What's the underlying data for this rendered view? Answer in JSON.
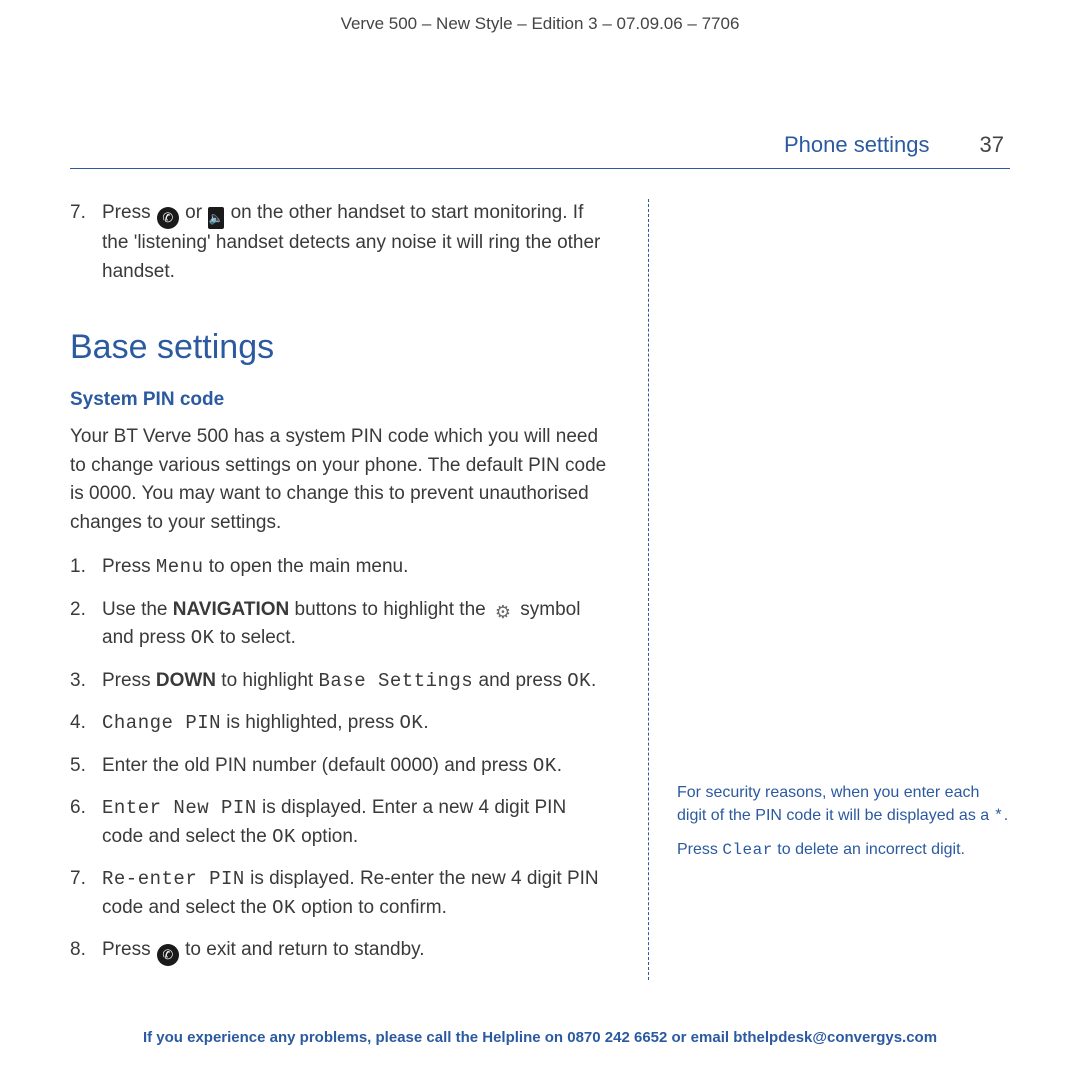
{
  "header": "Verve 500 – New Style – Edition 3 – 07.09.06 – 7706",
  "section": {
    "title": "Phone settings",
    "page": "37"
  },
  "top_step": {
    "n": "7.",
    "t1": "Press ",
    "t2": " or ",
    "t3": " on the other handset to start monitoring. If the 'listening' handset detects any noise it will ring the other handset."
  },
  "heading": "Base settings",
  "subheading": "System PIN code",
  "intro": "Your BT Verve 500 has a system PIN code which you will need to change various settings on your phone. The default PIN code is 0000. You may want to change this to prevent unauthorised changes to your settings.",
  "steps": {
    "s1a": "Press ",
    "s1_menu": "Menu",
    "s1b": " to open the main menu.",
    "s2a": "Use the ",
    "s2_nav": "NAVIGATION",
    "s2b": " buttons to highlight the ",
    "s2c": " symbol and press ",
    "s2_ok": "OK",
    "s2d": " to select.",
    "s3a": "Press ",
    "s3_down": "DOWN",
    "s3b": " to highlight ",
    "s3_bs": "Base Settings",
    "s3c": " and press ",
    "s3_ok": "OK",
    "s3d": ".",
    "s4_cp": "Change PIN",
    "s4a": " is highlighted, press ",
    "s4_ok": "OK",
    "s4b": ".",
    "s5a": "Enter the old PIN number (default 0000) and press ",
    "s5_ok": "OK",
    "s5b": ".",
    "s6_enp": "Enter New PIN",
    "s6a": " is displayed. Enter a new 4 digit PIN code and select the ",
    "s6_ok": "OK",
    "s6b": " option.",
    "s7_rep": "Re-enter PIN",
    "s7a": " is displayed. Re-enter the new 4 digit PIN code and select the ",
    "s7_ok": "OK",
    "s7b": " option to confirm.",
    "s8a": "Press ",
    "s8b": " to exit and return to standby."
  },
  "sidenote": {
    "p1a": "For security reasons, when you enter each digit of the PIN code it will be displayed as a ",
    "p1_star": "*",
    "p1b": ".",
    "p2a": "Press ",
    "p2_clear": "Clear",
    "p2b": " to delete an incorrect digit."
  },
  "footer": "If you experience any problems, please call the Helpline on 0870 242 6652 or email bthelpdesk@convergys.com"
}
